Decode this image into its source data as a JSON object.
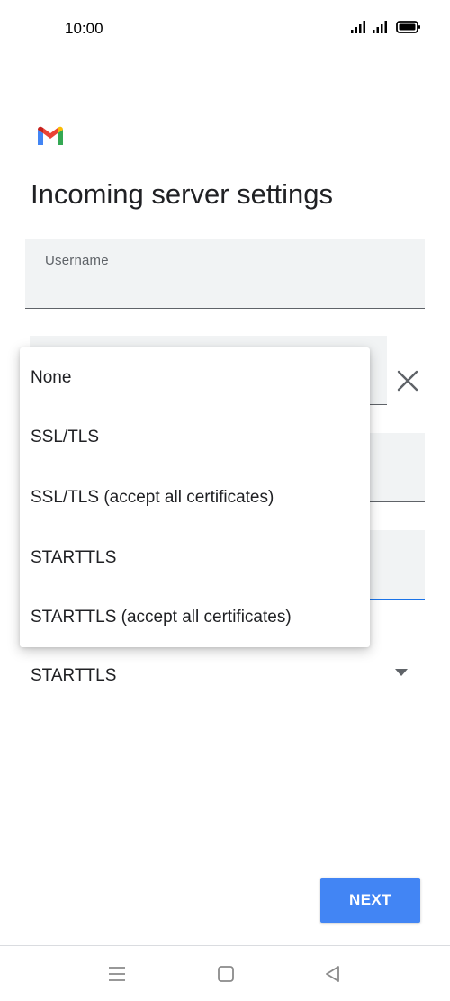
{
  "status_bar": {
    "time": "10:00",
    "icons": [
      "signal-icon",
      "signal-icon",
      "battery-icon"
    ]
  },
  "app": {
    "logo": "gmail-logo",
    "title": "Incoming server settings"
  },
  "form": {
    "username_label": "Username",
    "security_type_value": "STARTTLS"
  },
  "security_menu": {
    "options": [
      "None",
      "SSL/TLS",
      "SSL/TLS (accept all certificates)",
      "STARTTLS",
      "STARTTLS (accept all certificates)"
    ]
  },
  "actions": {
    "next_label": "NEXT"
  },
  "nav_bar": {
    "icons": [
      "menu-icon",
      "home-icon",
      "back-icon"
    ]
  },
  "colors": {
    "accent": "#4285f4",
    "focus_underline": "#1a73e8",
    "field_background": "#f1f3f4"
  }
}
